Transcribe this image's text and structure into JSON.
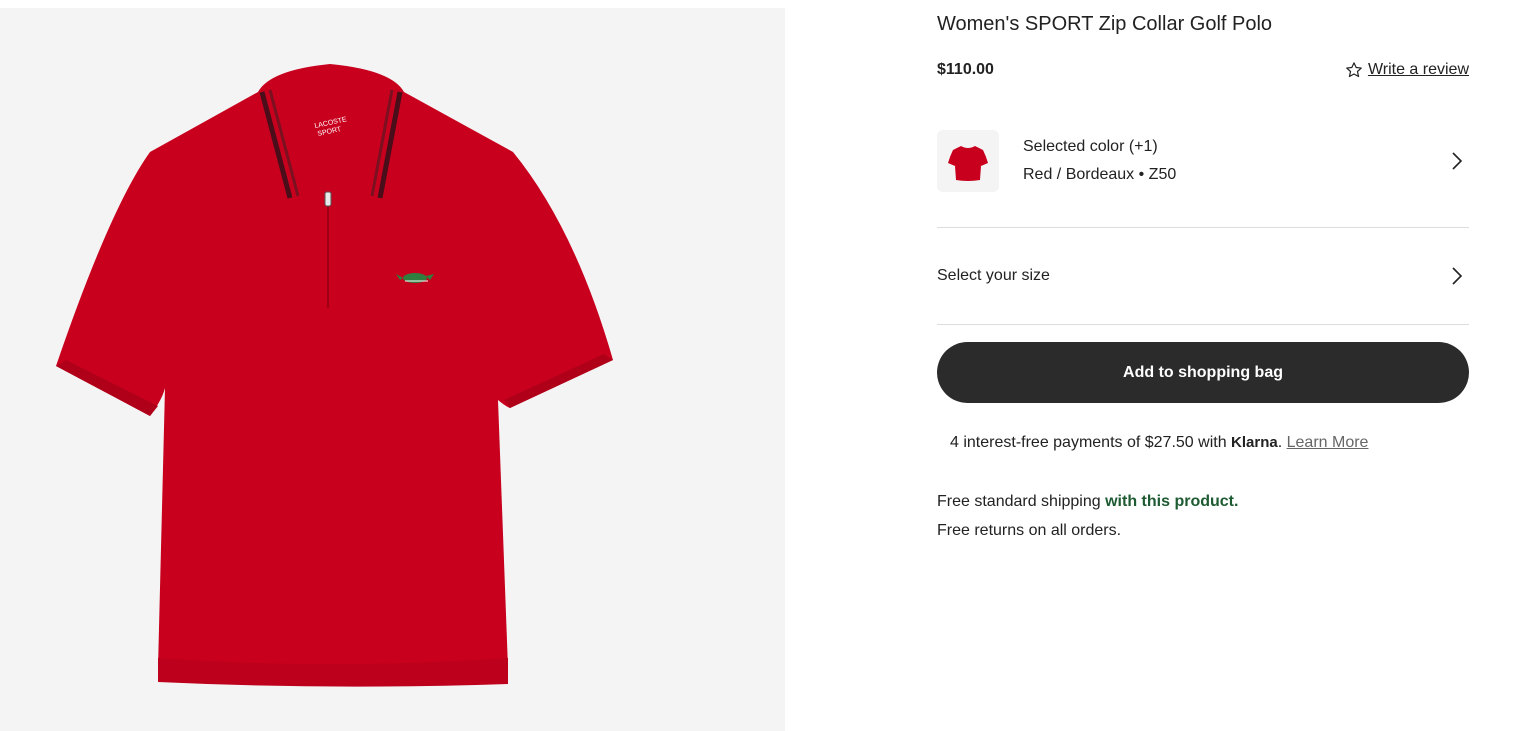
{
  "product": {
    "title": "Women's SPORT Zip Collar Golf Polo",
    "price": "$110.00",
    "image_alt": "Red polo shirt with zip collar"
  },
  "review": {
    "icon": "star-outline-icon",
    "label": "Write a review"
  },
  "color": {
    "heading": "Selected color (+1)",
    "value": "Red / Bordeaux • Z50",
    "swatch_hex": "#c8001e"
  },
  "size": {
    "label": "Select your size"
  },
  "cart": {
    "add_label": "Add to shopping bag"
  },
  "klarna": {
    "text": "4 interest-free payments of $27.50 with ",
    "brand": "Klarna",
    "suffix": ". ",
    "link": "Learn More"
  },
  "shipping": {
    "line1_prefix": "Free standard shipping ",
    "line1_highlight": "with this product.",
    "line2": "Free returns on all orders."
  },
  "colors": {
    "accent_green": "#1e5a32",
    "button_bg": "#2b2b2b",
    "polo_red": "#c8001e"
  }
}
